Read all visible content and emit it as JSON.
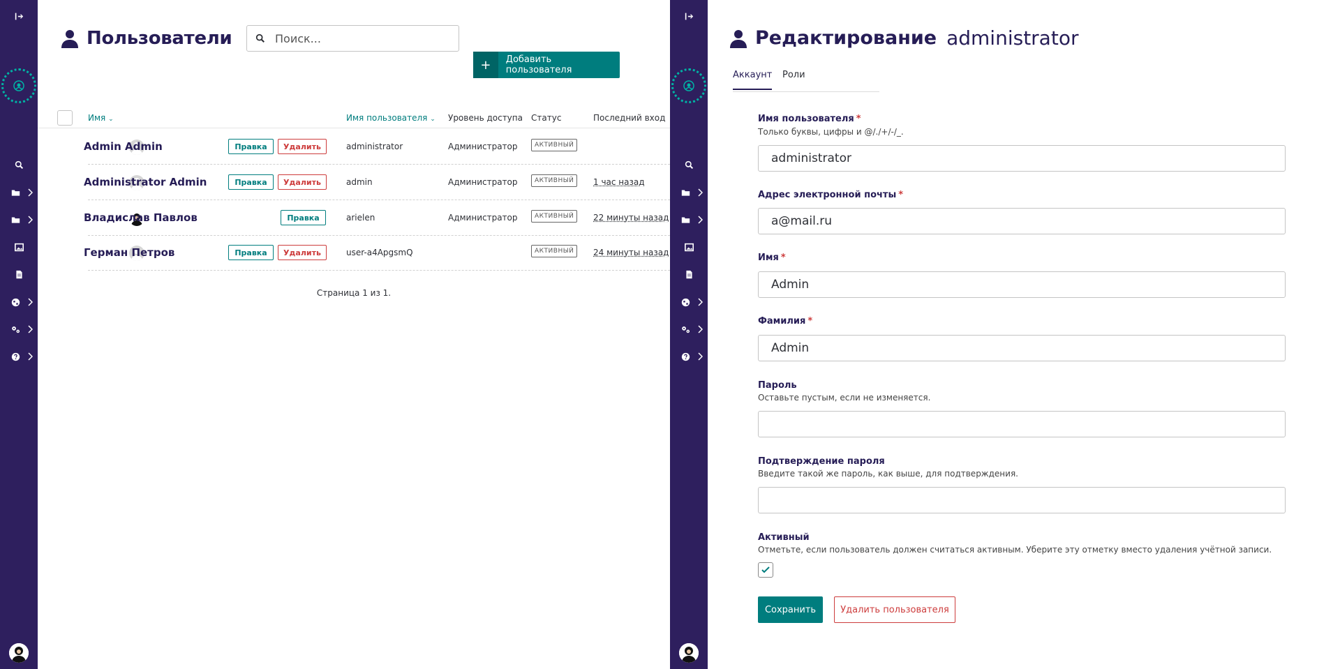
{
  "list": {
    "title": "Пользователи",
    "search_placeholder": "Поиск...",
    "add_button": "Добавить пользователя",
    "columns": {
      "name": "Имя",
      "username": "Имя пользователя",
      "access": "Уровень доступа",
      "status": "Статус",
      "last_login": "Последний вход"
    },
    "rows": [
      {
        "name": "Admin Admin",
        "username": "administrator",
        "access": "Администратор",
        "status": "АКТИВНЫЙ",
        "last_login": ""
      },
      {
        "name": "Administrator Admin",
        "username": "admin",
        "access": "Администратор",
        "status": "АКТИВНЫЙ",
        "last_login": "1 час назад"
      },
      {
        "name": "Владислав Павлов",
        "username": "arielen",
        "access": "Администратор",
        "status": "АКТИВНЫЙ",
        "last_login": "22 минуты назад"
      },
      {
        "name": "Герман Петров",
        "username": "user-a4ApgsmQ",
        "access": "",
        "status": "АКТИВНЫЙ",
        "last_login": "24 минуты назад"
      }
    ],
    "edit_label": "Правка",
    "delete_label": "Удалить",
    "pagination": "Страница 1 из 1."
  },
  "edit": {
    "title": "Редактирование",
    "subject": "administrator",
    "tabs": [
      "Аккаунт",
      "Роли"
    ],
    "fields": {
      "username": {
        "label": "Имя пользователя",
        "req": "*",
        "help": "Только буквы, цифры и @/./+/-/_.",
        "value": "administrator"
      },
      "email": {
        "label": "Адрес электронной почты",
        "req": "*",
        "value": "a@mail.ru"
      },
      "first_name": {
        "label": "Имя",
        "req": "*",
        "value": "Admin"
      },
      "last_name": {
        "label": "Фамилия",
        "req": "*",
        "value": "Admin"
      },
      "password": {
        "label": "Пароль",
        "help": "Оставьте пустым, если не изменяется.",
        "value": ""
      },
      "password_confirm": {
        "label": "Подтверждение пароля",
        "help": "Введите такой же пароль, как выше, для подтверждения.",
        "value": ""
      },
      "active": {
        "label": "Активный",
        "help": "Отметьте, если пользователь должен считаться активным. Уберите эту отметку вместо удаления учётной записи.",
        "checked": true
      }
    },
    "save_label": "Сохранить",
    "delete_user_label": "Удалить пользователя"
  },
  "colors": {
    "sidebar": "#2e1f5e",
    "primary": "#007d7e",
    "danger": "#cd3c3c",
    "title": "#261d56"
  },
  "icons": [
    "expand-icon",
    "logo-icon",
    "search-icon",
    "folder-icon",
    "image-icon",
    "document-icon",
    "globe-icon",
    "cogs-icon",
    "help-icon",
    "user-icon"
  ]
}
